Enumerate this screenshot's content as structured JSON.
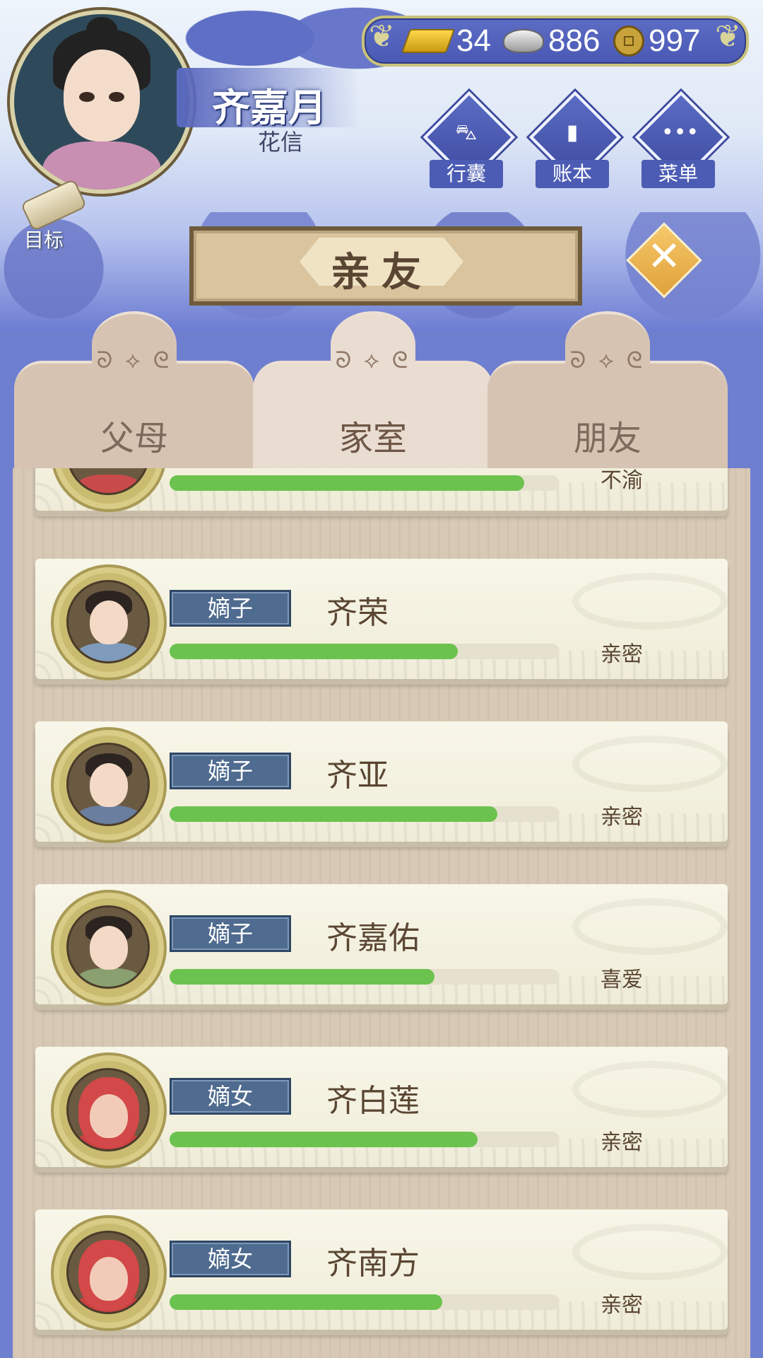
{
  "player": {
    "name": "齐嘉月",
    "title": "花信"
  },
  "currency": {
    "gold": "34",
    "silver": "886",
    "coins": "997"
  },
  "menu": {
    "bag": "行囊",
    "ledger": "账本",
    "menu": "菜单"
  },
  "goal_label": "目标",
  "panel_title": "亲友",
  "close_glyph": "✕",
  "tabs": [
    {
      "label": "父母",
      "active": false
    },
    {
      "label": "家室",
      "active": true
    },
    {
      "label": "朋友",
      "active": false
    }
  ],
  "relations": {
    "partial_row": {
      "relation": "不渝",
      "progress": 0.91
    },
    "rows": [
      {
        "tag": "嫡子",
        "name": "齐荣",
        "relation": "亲密",
        "progress": 0.74
      },
      {
        "tag": "嫡子",
        "name": "齐亚",
        "relation": "亲密",
        "progress": 0.84
      },
      {
        "tag": "嫡子",
        "name": "齐嘉佑",
        "relation": "喜爱",
        "progress": 0.68
      },
      {
        "tag": "嫡女",
        "name": "齐白莲",
        "relation": "亲密",
        "progress": 0.79
      },
      {
        "tag": "嫡女",
        "name": "齐南方",
        "relation": "亲密",
        "progress": 0.7
      }
    ]
  },
  "colors": {
    "progress": "#6cc24e",
    "tag_bg": "#4f6b8f",
    "background": "#6f7fd0"
  }
}
